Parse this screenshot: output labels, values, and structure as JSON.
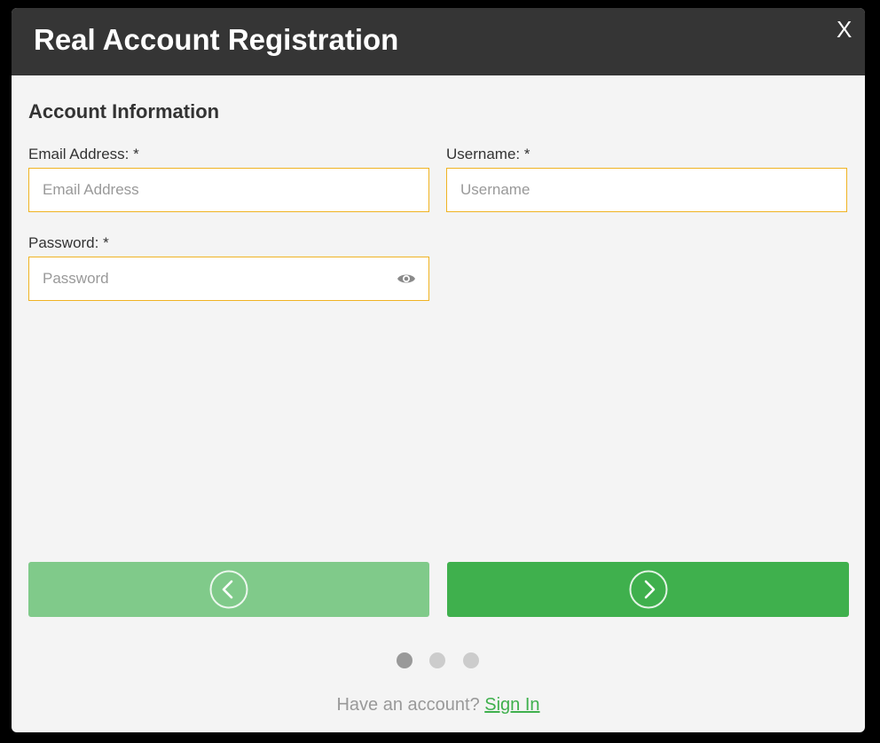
{
  "modal": {
    "title": "Real Account Registration",
    "close_label": "X"
  },
  "section": {
    "title": "Account Information"
  },
  "fields": {
    "email": {
      "label": "Email Address: *",
      "placeholder": "Email Address",
      "value": ""
    },
    "username": {
      "label": "Username: *",
      "placeholder": "Username",
      "value": ""
    },
    "password": {
      "label": "Password: *",
      "placeholder": "Password",
      "value": ""
    }
  },
  "navigation": {
    "prev_icon": "chevron-left-icon",
    "next_icon": "chevron-right-icon",
    "steps_total": 3,
    "current_step": 1
  },
  "footer": {
    "prompt": "Have an account?",
    "link": "Sign In"
  },
  "colors": {
    "header_bg": "#353535",
    "field_border": "#f0b323",
    "primary_green": "#3fb04d",
    "disabled_green": "#80ca8a",
    "dot_active": "#999999",
    "dot_inactive": "#cccccc"
  }
}
